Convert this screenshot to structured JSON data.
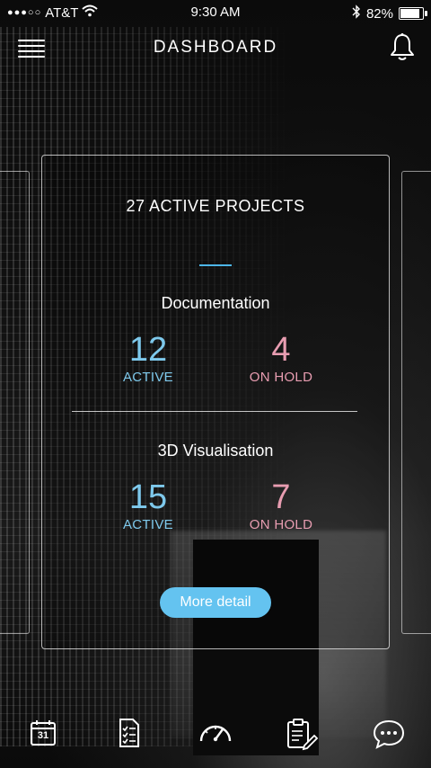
{
  "status_bar": {
    "signal_dots": "●●●○○",
    "carrier": "AT&T",
    "time": "9:30 AM",
    "battery": "82%",
    "battery_level": 0.82
  },
  "header": {
    "title": "DASHBOARD",
    "menu_icon": "hamburger-menu-icon",
    "notification_icon": "bell-icon"
  },
  "card": {
    "heading": "27 ACTIVE PROJECTS",
    "groups": [
      {
        "title": "Documentation",
        "active_count": "12",
        "active_label": "ACTIVE",
        "hold_count": "4",
        "hold_label": "ON HOLD"
      },
      {
        "title": "3D Visualisation",
        "active_count": "15",
        "active_label": "ACTIVE",
        "hold_count": "7",
        "hold_label": "ON HOLD"
      }
    ],
    "button_label": "More detail"
  },
  "colors": {
    "active": "#7ec9ec",
    "on_hold": "#e89db1",
    "accent": "#4db6e8",
    "button": "#64c3f0"
  },
  "tab_bar": {
    "calendar_day": "31",
    "icons": [
      "calendar-icon",
      "checklist-icon",
      "speedometer-icon",
      "clipboard-edit-icon",
      "chat-icon"
    ]
  }
}
